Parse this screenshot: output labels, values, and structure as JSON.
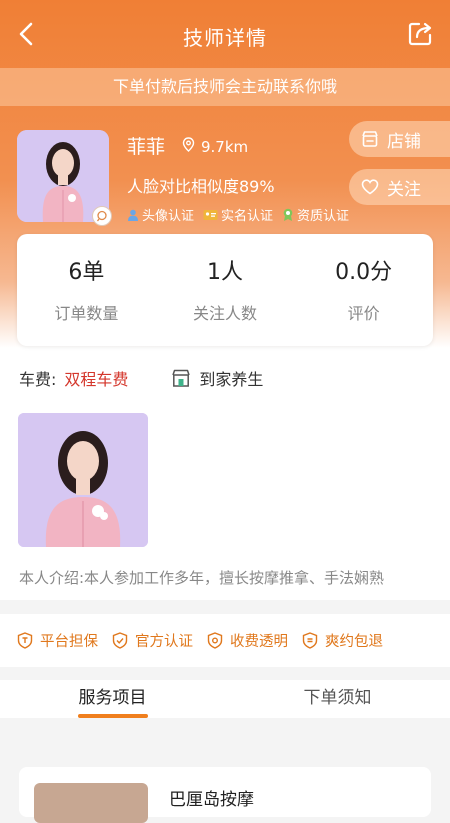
{
  "nav": {
    "title": "技师详情"
  },
  "notice": "下单付款后技师会主动联系你哦",
  "profile": {
    "name": "菲菲",
    "distance": "9.7km",
    "similarity": "人脸对比相似度89%",
    "certs": [
      {
        "label": "头像认证",
        "icon": "user-icon",
        "color": "#6aa6e8"
      },
      {
        "label": "实名认证",
        "icon": "id-card-icon",
        "color": "#f0b53a"
      },
      {
        "label": "资质认证",
        "icon": "medal-icon",
        "color": "#7fc65a"
      }
    ]
  },
  "actions": {
    "shop_label": "店铺",
    "follow_label": "关注"
  },
  "stats": [
    {
      "value": "6单",
      "label": "订单数量"
    },
    {
      "value": "1人",
      "label": "关注人数"
    },
    {
      "value": "0.0分",
      "label": "评价"
    }
  ],
  "fee": {
    "label": "车费:",
    "value": "双程车费",
    "service_type": "到家养生"
  },
  "intro": "本人介绍:本人参加工作多年，擅长按摩推拿、手法娴熟",
  "guarantees": [
    "平台担保",
    "官方认证",
    "收费透明",
    "爽约包退"
  ],
  "tabs": [
    "服务项目",
    "下单须知"
  ],
  "service": {
    "name": "巴厘岛按摩"
  },
  "colors": {
    "accent": "#f07f1d",
    "fee_red": "#d4372c"
  }
}
